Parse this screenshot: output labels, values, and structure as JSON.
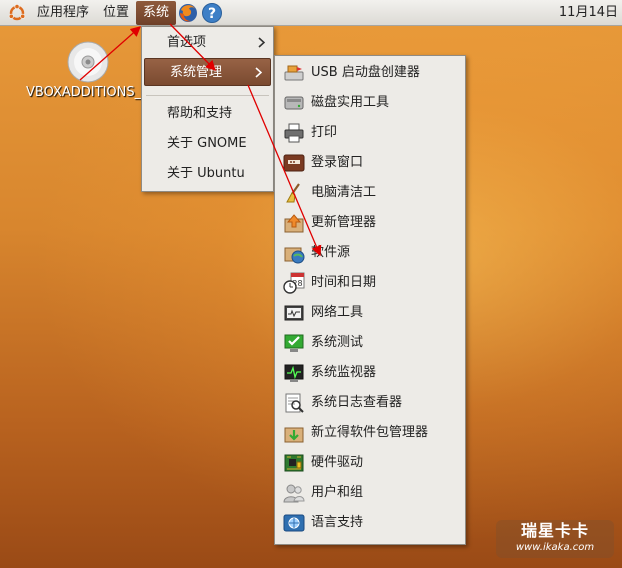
{
  "panel": {
    "menus": [
      "应用程序",
      "位置",
      "系统"
    ],
    "clock": "11月14日"
  },
  "desktop": {
    "icon_label": "VBOXADDITIONS_"
  },
  "system_menu": {
    "items": [
      {
        "label": "首选项",
        "submenu": true
      },
      {
        "label": "系统管理",
        "submenu": true,
        "selected": true
      },
      {
        "label": "帮助和支持",
        "submenu": false
      },
      {
        "label": "关于 GNOME",
        "submenu": false
      },
      {
        "label": "关于 Ubuntu",
        "submenu": false
      }
    ]
  },
  "admin_menu": {
    "items": [
      {
        "label": "USB 启动盘创建器",
        "icon": "usb-creator-icon"
      },
      {
        "label": "磁盘实用工具",
        "icon": "disk-utility-icon"
      },
      {
        "label": "打印",
        "icon": "printer-icon"
      },
      {
        "label": "登录窗口",
        "icon": "login-window-icon"
      },
      {
        "label": "电脑清洁工",
        "icon": "broom-icon"
      },
      {
        "label": "更新管理器",
        "icon": "update-manager-icon"
      },
      {
        "label": "软件源",
        "icon": "software-sources-icon"
      },
      {
        "label": "时间和日期",
        "icon": "clock-calendar-icon"
      },
      {
        "label": "网络工具",
        "icon": "network-tools-icon"
      },
      {
        "label": "系统测试",
        "icon": "checkmark-monitor-icon"
      },
      {
        "label": "系统监视器",
        "icon": "system-monitor-icon"
      },
      {
        "label": "系统日志查看器",
        "icon": "log-viewer-icon"
      },
      {
        "label": "新立得软件包管理器",
        "icon": "synaptic-icon"
      },
      {
        "label": "硬件驱动",
        "icon": "hardware-driver-icon"
      },
      {
        "label": "用户和组",
        "icon": "users-icon"
      },
      {
        "label": "语言支持",
        "icon": "language-support-icon"
      }
    ]
  },
  "watermark": {
    "line1": "瑞星卡卡",
    "line2": "www.ikaka.com"
  }
}
